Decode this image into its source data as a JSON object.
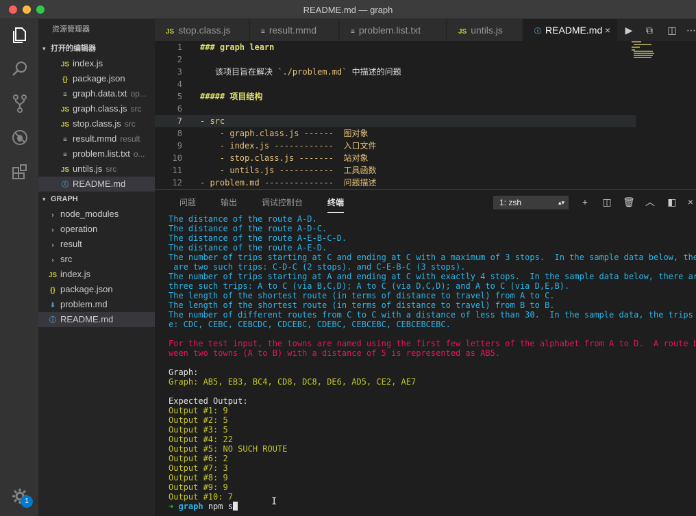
{
  "window": {
    "title": "README.md — graph"
  },
  "sidebar": {
    "title": "资源管理器",
    "open_editors": {
      "label": "打开的编辑器",
      "items": [
        {
          "icon": "JS",
          "name": "index.js",
          "hint": ""
        },
        {
          "icon": "{}",
          "name": "package.json",
          "hint": ""
        },
        {
          "icon": "≡",
          "name": "graph.data.txt",
          "hint": "op..."
        },
        {
          "icon": "JS",
          "name": "graph.class.js",
          "hint": "src"
        },
        {
          "icon": "JS",
          "name": "stop.class.js",
          "hint": "src"
        },
        {
          "icon": "≡",
          "name": "result.mmd",
          "hint": "result"
        },
        {
          "icon": "≡",
          "name": "problem.list.txt",
          "hint": "o..."
        },
        {
          "icon": "JS",
          "name": "untils.js",
          "hint": "src"
        },
        {
          "icon": "ⓘ",
          "name": "README.md",
          "hint": ""
        }
      ]
    },
    "workspace": {
      "label": "GRAPH",
      "items": [
        {
          "icon": "›",
          "name": "node_modules"
        },
        {
          "icon": "›",
          "name": "operation"
        },
        {
          "icon": "›",
          "name": "result"
        },
        {
          "icon": "›",
          "name": "src"
        },
        {
          "icon": "JS",
          "name": "index.js"
        },
        {
          "icon": "{}",
          "name": "package.json"
        },
        {
          "icon": "⬇",
          "name": "problem.md"
        },
        {
          "icon": "ⓘ",
          "name": "README.md"
        }
      ]
    }
  },
  "activity_badge": "1",
  "tabs": [
    {
      "icon": "JS",
      "label": "stop.class.js"
    },
    {
      "icon": "≡",
      "label": "result.mmd"
    },
    {
      "icon": "≡",
      "label": "problem.list.txt"
    },
    {
      "icon": "JS",
      "label": "untils.js"
    },
    {
      "icon": "ⓘ",
      "label": "README.md"
    }
  ],
  "editor": {
    "line_numbers": [
      "1",
      "2",
      "3",
      "4",
      "5",
      "6",
      "7",
      "8",
      "9",
      "10",
      "11",
      "12"
    ],
    "lines": {
      "l1": "### graph learn",
      "l3a": "该项目旨在解决 ",
      "l3b": "`./problem.md`",
      "l3c": " 中描述的问题",
      "l5": "##### 项目结构",
      "l7": "- src",
      "l8a": "    - graph.class.js ------  ",
      "l8b": "图对象",
      "l9a": "    - index.js ------------  ",
      "l9b": "入口文件",
      "l10a": "    - stop.class.js -------  ",
      "l10b": "站对象",
      "l11a": "    - untils.js -----------  ",
      "l11b": "工具函数",
      "l12a": "- problem.md --------------  ",
      "l12b": "问题描述"
    }
  },
  "panel": {
    "tabs": [
      "问题",
      "输出",
      "调试控制台",
      "终端"
    ],
    "terminal_select": "1: zsh"
  },
  "terminal": {
    "cyan_lines": [
      "The distance of the route A-D.",
      "The distance of the route A-D-C.",
      "The distance of the route A-E-B-C-D.",
      "The distance of the route A-E-D.",
      "The number of trips starting at C and ending at C with a maximum of 3 stops.  In the sample data below, there",
      " are two such trips: C-D-C (2 stops). and C-E-B-C (3 stops).",
      "The number of trips starting at A and ending at C with exactly 4 stops.  In the sample data below, there are",
      "three such trips: A to C (via B,C,D); A to C (via D,C,D); and A to C (via D,E,B).",
      "The length of the shortest route (in terms of distance to travel) from A to C.",
      "The length of the shortest route (in terms of distance to travel) from B to B.",
      "The number of different routes from C to C with a distance of less than 30.  In the sample data, the trips ar",
      "e: CDC, CEBC, CEBCDC, CDCEBC, CDEBC, CEBCEBC, CEBCEBCEBC."
    ],
    "red_lines": [
      "For the test input, the towns are named using the first few letters of the alphabet from A to D.  A route bet",
      "ween two towns (A to B) with a distance of 5 is represented as AB5."
    ],
    "graph_label": "Graph:",
    "graph_value": "Graph: AB5, EB3, BC4, CD8, DC8, DE6, AD5, CE2, AE7",
    "expected_label": "Expected Output:",
    "outputs": [
      "Output #1: 9",
      "Output #2: 5",
      "Output #3: 5",
      "Output #4: 22",
      "Output #5: NO SUCH ROUTE",
      "Output #6: 2",
      "Output #7: 3",
      "Output #8: 9",
      "Output #9: 9",
      "Output #10: 7"
    ],
    "prompt_arrow": "➜",
    "prompt_dir": "graph",
    "prompt_cmd": " npm s"
  }
}
